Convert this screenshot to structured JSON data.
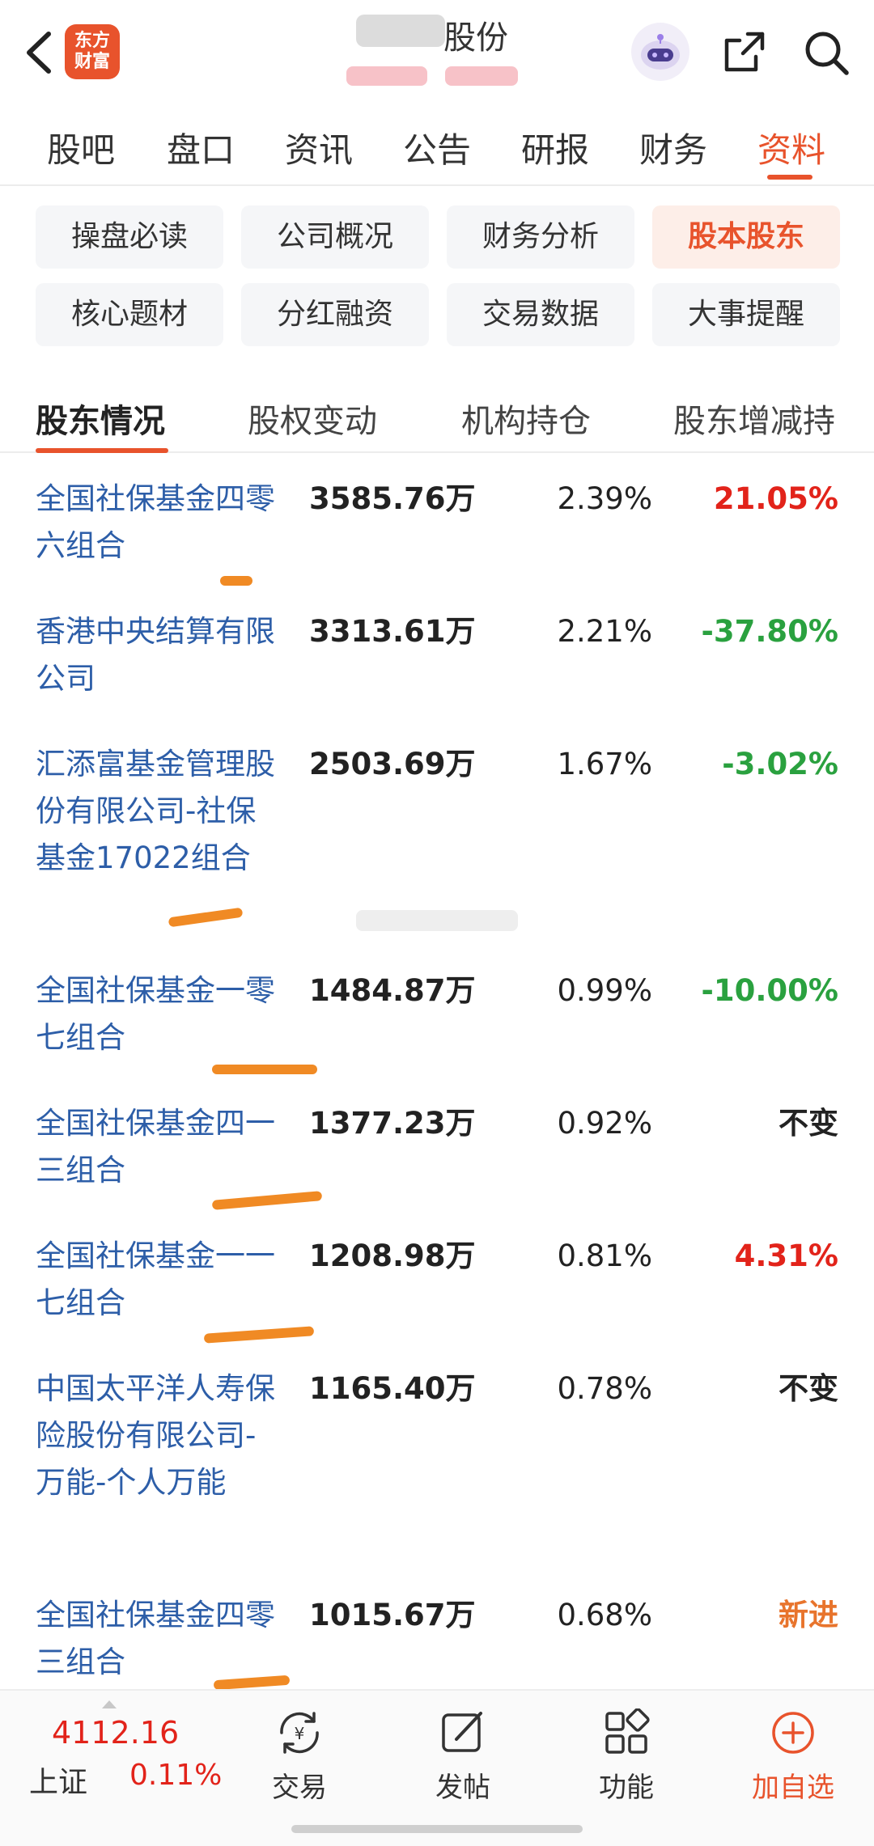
{
  "header": {
    "logo_line1": "东方",
    "logo_line2": "财富",
    "title": "股份"
  },
  "main_tabs": [
    {
      "label": "股吧"
    },
    {
      "label": "盘口"
    },
    {
      "label": "资讯"
    },
    {
      "label": "公告"
    },
    {
      "label": "研报"
    },
    {
      "label": "财务"
    },
    {
      "label": "资料",
      "active": true
    }
  ],
  "sub_categories": [
    {
      "label": "操盘必读"
    },
    {
      "label": "公司概况"
    },
    {
      "label": "财务分析"
    },
    {
      "label": "股本股东",
      "active": true
    },
    {
      "label": "核心题材"
    },
    {
      "label": "分红融资"
    },
    {
      "label": "交易数据"
    },
    {
      "label": "大事提醒"
    }
  ],
  "section_tabs": [
    {
      "label": "股东情况",
      "active": true
    },
    {
      "label": "股权变动"
    },
    {
      "label": "机构持仓"
    },
    {
      "label": "股东增减持"
    }
  ],
  "holders": [
    {
      "name": "全国社保基金四零六组合",
      "shares": "3585.76万",
      "ratio": "2.39%",
      "change": "21.05%",
      "trend": "up"
    },
    {
      "name": "香港中央结算有限公司",
      "shares": "3313.61万",
      "ratio": "2.21%",
      "change": "-37.80%",
      "trend": "down"
    },
    {
      "name": "汇添富基金管理股份有限公司-社保基金17022组合",
      "shares": "2503.69万",
      "ratio": "1.67%",
      "change": "-3.02%",
      "trend": "down"
    },
    {
      "name": "全国社保基金一零七组合",
      "shares": "1484.87万",
      "ratio": "0.99%",
      "change": "-10.00%",
      "trend": "down"
    },
    {
      "name": "全国社保基金四一三组合",
      "shares": "1377.23万",
      "ratio": "0.92%",
      "change": "不变",
      "trend": "flat"
    },
    {
      "name": "全国社保基金一一七组合",
      "shares": "1208.98万",
      "ratio": "0.81%",
      "change": "4.31%",
      "trend": "up"
    },
    {
      "name": "中国太平洋人寿保险股份有限公司-万能-个人万能",
      "shares": "1165.40万",
      "ratio": "0.78%",
      "change": "不变",
      "trend": "flat"
    },
    {
      "name": "全国社保基金四零三组合",
      "shares": "1015.67万",
      "ratio": "0.68%",
      "change": "新进",
      "trend": "new"
    }
  ],
  "bottom_bar": {
    "index_value": "4112.16",
    "index_name": "上证",
    "index_change": "0.11%",
    "items": [
      {
        "label": "交易",
        "icon": "trade-yen-icon"
      },
      {
        "label": "发帖",
        "icon": "post-edit-icon"
      },
      {
        "label": "功能",
        "icon": "function-grid-icon"
      },
      {
        "label": "加自选",
        "icon": "add-circle-icon"
      }
    ]
  },
  "colors": {
    "accent": "#e8532c",
    "up": "#e2231a",
    "down": "#2aa13f",
    "link": "#2d5ea8",
    "highlight_mark": "#f08a24"
  }
}
